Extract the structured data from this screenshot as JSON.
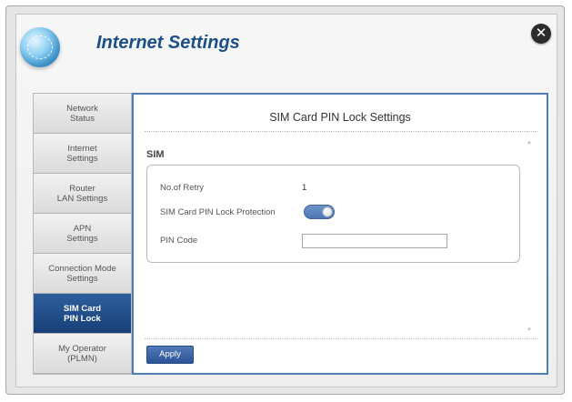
{
  "window": {
    "title": "Internet Settings",
    "close_glyph": "✕"
  },
  "sidebar": {
    "items": [
      {
        "label": "Network\nStatus",
        "active": false
      },
      {
        "label": "Internet\nSettings",
        "active": false
      },
      {
        "label": "Router\nLAN Settings",
        "active": false
      },
      {
        "label": "APN\nSettings",
        "active": false
      },
      {
        "label": "Connection Mode\nSettings",
        "active": false
      },
      {
        "label": "SIM Card\nPIN Lock",
        "active": true
      },
      {
        "label": "My Operator\n(PLMN)",
        "active": false
      }
    ]
  },
  "panel": {
    "title": "SIM Card PIN Lock Settings",
    "section_label": "SIM",
    "fields": {
      "retry_label": "No.of Retry",
      "retry_value": "1",
      "protection_label": "SIM Card PIN Lock Protection",
      "protection_enabled": true,
      "pin_label": "PIN Code",
      "pin_value": ""
    },
    "apply_label": "Apply"
  },
  "colors": {
    "title": "#1b4f87",
    "active_nav": "#173f78",
    "panel_border": "#4f7db2",
    "toggle": "#4d76b3"
  },
  "icons": {
    "logo": "globe-icon",
    "close": "close-icon",
    "scroll_up": "scroll-up-arrow-icon",
    "scroll_down": "scroll-down-arrow-icon"
  }
}
